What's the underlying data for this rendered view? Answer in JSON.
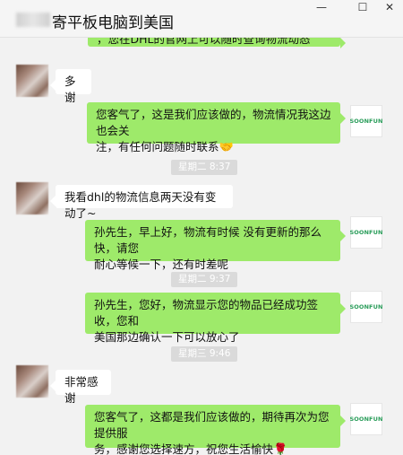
{
  "window": {
    "title": "寄平板电脑到美国",
    "minimize_icon": "minimize-icon",
    "maximize_icon": "maximize-icon",
    "close_icon": "close-icon",
    "min_glyph": "—",
    "max_glyph": "☐",
    "close_glyph": "✕"
  },
  "brand": {
    "avatar_text": "SOONFUN",
    "accent": "#2a9d5a"
  },
  "colors": {
    "sent_bubble": "#9eea6a",
    "received_bubble": "#ffffff",
    "background": "#f2f2f2",
    "timestamp_bg": "#dadada"
  },
  "messages": {
    "m0": {
      "text": "，您在DHL的官网上可以随时查询物流动态"
    },
    "m1": {
      "text": "多谢"
    },
    "m2": {
      "line1": "您客气了，这是我们应该做的，物流情况我这边也会关",
      "line2": "注，有任何问题随时联系",
      "emoji": "🤝"
    },
    "t1": {
      "text": "星期二 8:37"
    },
    "m3": {
      "text": "我看dhl的物流信息两天没有变动了~"
    },
    "m4": {
      "line1": "孙先生，早上好，物流有时候 没有更新的那么快，请您",
      "line2": "耐心等候一下，还有时差呢"
    },
    "t2": {
      "text": "星期二 9:37"
    },
    "m5": {
      "line1": "孙先生，您好，物流显示您的物品已经成功签收，您和",
      "line2": "美国那边确认一下可以放心了"
    },
    "t3": {
      "text": "星期三 9:46"
    },
    "m6": {
      "text": "非常感谢"
    },
    "m7": {
      "line1": "您客气了，这都是我们应该做的，期待再次为您提供服",
      "line2": "务，感谢您选择速方，祝您生活愉快",
      "emoji": "🌹"
    }
  }
}
